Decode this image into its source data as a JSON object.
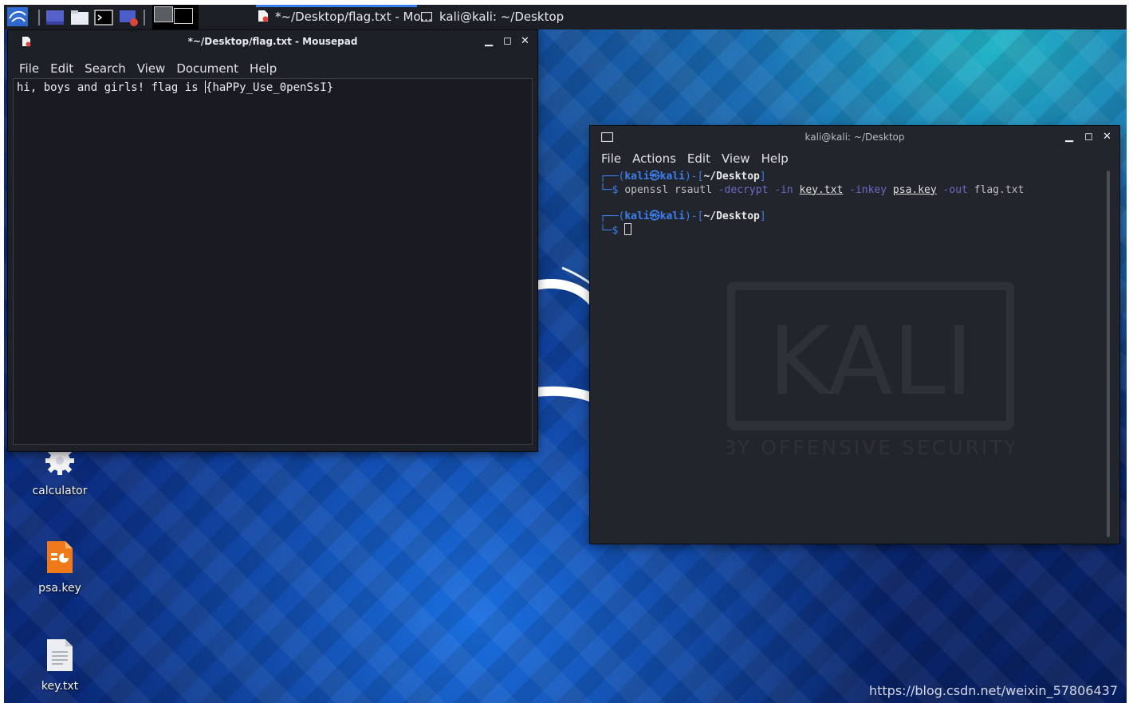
{
  "taskbar": {
    "tasks": [
      {
        "label": "*~/Desktop/flag.txt - Mo...",
        "icon": "mousepad-icon"
      },
      {
        "label": "kali@kali: ~/Desktop",
        "icon": "terminal-icon"
      }
    ]
  },
  "mousepad": {
    "title": "*~/Desktop/flag.txt - Mousepad",
    "menu": [
      "File",
      "Edit",
      "Search",
      "View",
      "Document",
      "Help"
    ],
    "content_before_cursor": "hi, boys and girls! flag is ",
    "content_after_cursor": "{haPPy_Use_0penSsI}"
  },
  "terminal": {
    "title": "kali@kali: ~/Desktop",
    "menu": [
      "File",
      "Actions",
      "Edit",
      "View",
      "Help"
    ],
    "prompt": {
      "open": "┌──(",
      "user": "kali",
      "at": "㉿",
      "host": "kali",
      "mid": ")-[",
      "path": "~/Desktop",
      "close": "]",
      "prefix": "└─$ "
    },
    "command": {
      "c1": "openssl",
      "c2": "rsautl",
      "o1": "-decrypt",
      "o2": "-in",
      "f1": "key.txt",
      "o3": "-inkey",
      "f2": "psa.key",
      "o4": "-out",
      "f3": "flag.txt"
    }
  },
  "wallpaper": {
    "brand": "KALI",
    "tagline": "BY OFFENSIVE SECURITY"
  },
  "desktop_icons": [
    {
      "label": "calculator",
      "icon": "gear-icon"
    },
    {
      "label": "psa.key",
      "icon": "presentation-file-icon"
    },
    {
      "label": "key.txt",
      "icon": "text-file-icon"
    }
  ],
  "footer_watermark": "https://blog.csdn.net/weixin_57806437",
  "colors": {
    "prompt_blue": "#3b7ef0",
    "option_purple": "#6b6bc7",
    "taskbar": "#1d1f26",
    "terminal_bg": "#23252c"
  }
}
